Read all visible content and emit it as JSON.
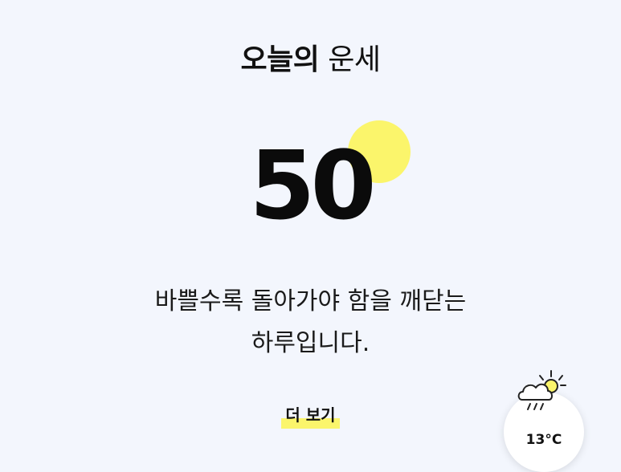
{
  "header": {
    "title_bold": "오늘의",
    "title_regular": "운세"
  },
  "fortune": {
    "score": "50",
    "message": "바쁠수록 돌아가야 함을 깨닫는 하루입니다."
  },
  "actions": {
    "more_label": "더 보기"
  },
  "weather": {
    "icon": "sun-cloud-rain-icon",
    "temperature": "13°C"
  },
  "colors": {
    "background": "#f3f6fd",
    "accent_yellow": "#fbf56b",
    "text": "#111111"
  }
}
